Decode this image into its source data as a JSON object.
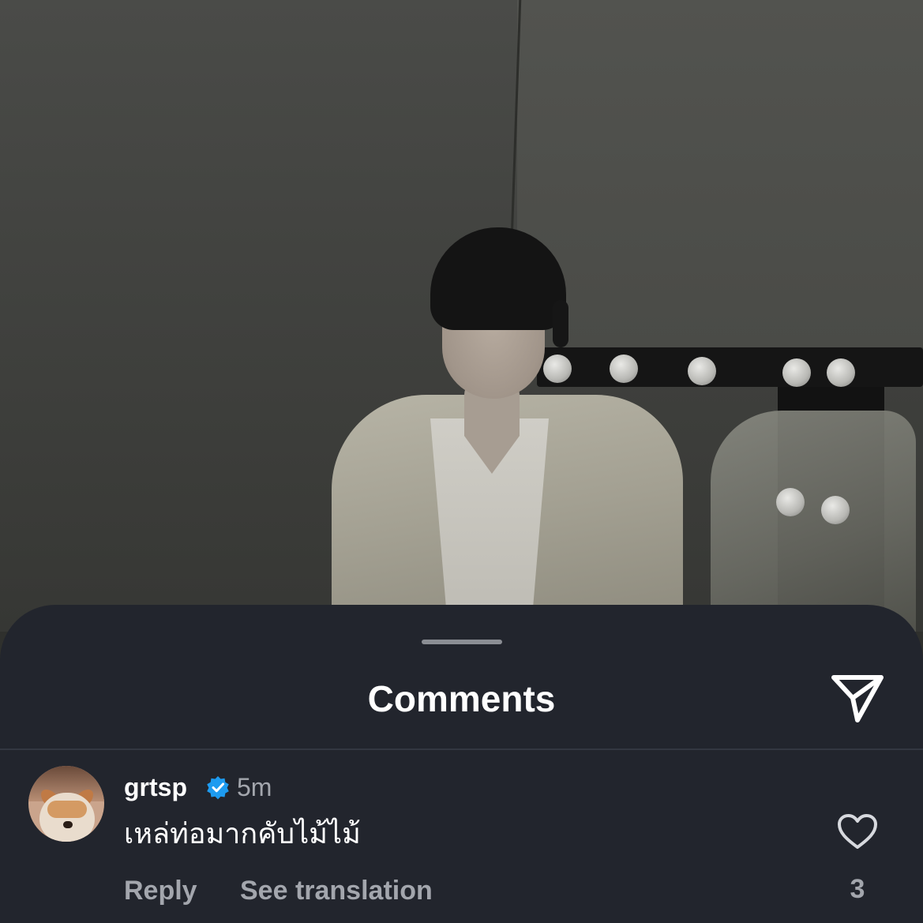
{
  "sheet": {
    "title": "Comments"
  },
  "comment": {
    "username": "grtsp",
    "verified": true,
    "timestamp": "5m",
    "text": "เหล่ท่อมากคับไม้ไม้",
    "reply_label": "Reply",
    "translate_label": "See translation",
    "like_count": "3"
  },
  "icons": {
    "share": "paper-plane-icon",
    "verified": "verified-badge-icon",
    "like": "heart-icon"
  },
  "colors": {
    "sheet_background": "#22252d",
    "verified_badge": "#1d9bf0",
    "secondary_text": "#a3a6ad"
  }
}
